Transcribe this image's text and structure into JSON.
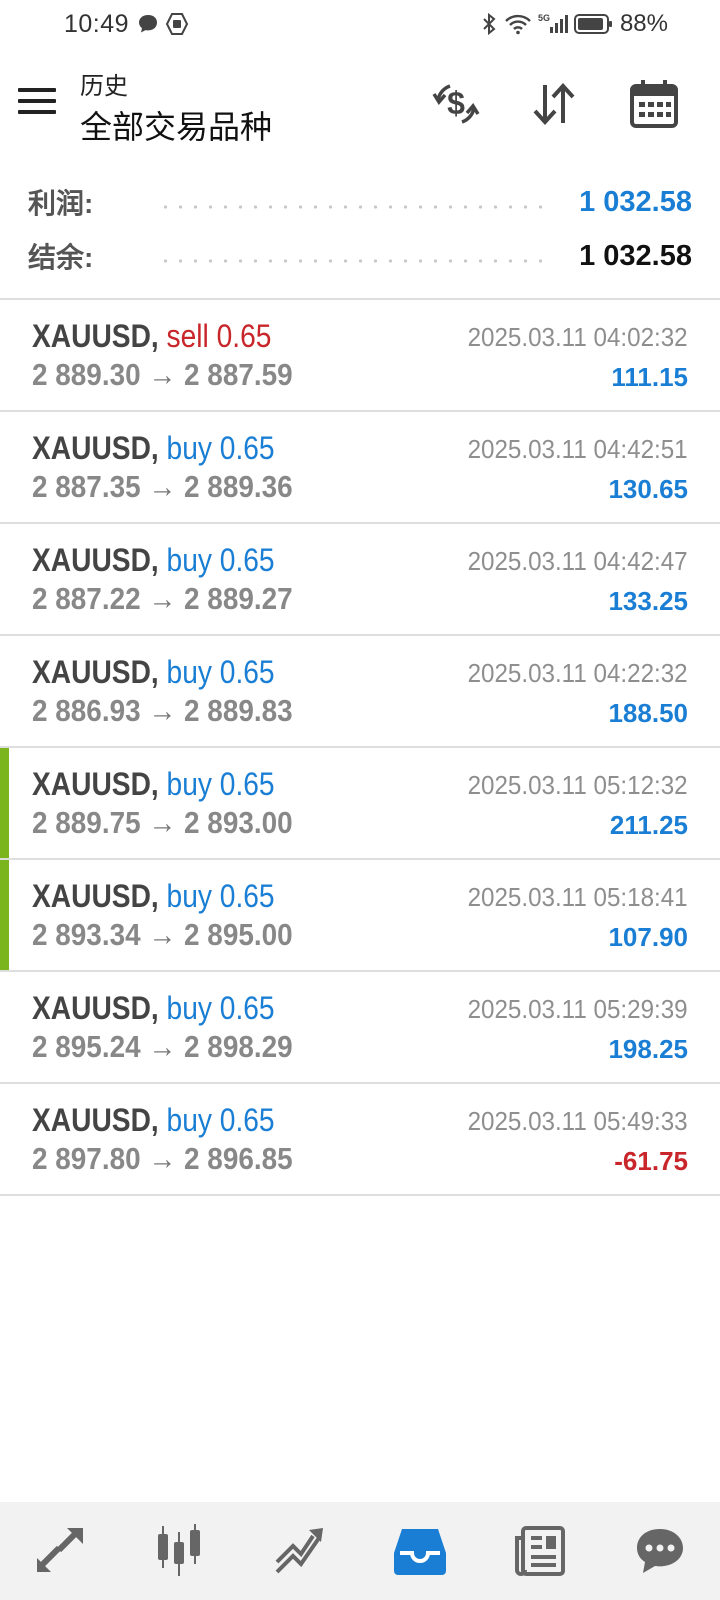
{
  "status_bar": {
    "time": "10:49",
    "battery": "88%",
    "icons": [
      "message-icon",
      "shield-icon",
      "bluetooth-icon",
      "wifi-icon",
      "5g-signal-icon",
      "battery-icon"
    ]
  },
  "header": {
    "subtitle": "历史",
    "title": "全部交易品种",
    "actions": [
      "currency-exchange-icon",
      "sort-icon",
      "calendar-icon"
    ]
  },
  "summary": {
    "profit_label": "利润:",
    "profit_value": "1 032.58",
    "balance_label": "结余:",
    "balance_value": "1 032.58"
  },
  "trades": [
    {
      "symbol": "XAUUSD",
      "sep": ",",
      "direction": "sell 0.65",
      "type": "sell",
      "open": "2 889.30",
      "arrow": "→",
      "close": "2 887.59",
      "datetime": "2025.03.11 04:02:32",
      "profit": "111.15",
      "profit_sign": "pos",
      "highlight": false
    },
    {
      "symbol": "XAUUSD",
      "sep": ",",
      "direction": "buy 0.65",
      "type": "buy",
      "open": "2 887.35",
      "arrow": "→",
      "close": "2 889.36",
      "datetime": "2025.03.11 04:42:51",
      "profit": "130.65",
      "profit_sign": "pos",
      "highlight": false
    },
    {
      "symbol": "XAUUSD",
      "sep": ",",
      "direction": "buy 0.65",
      "type": "buy",
      "open": "2 887.22",
      "arrow": "→",
      "close": "2 889.27",
      "datetime": "2025.03.11 04:42:47",
      "profit": "133.25",
      "profit_sign": "pos",
      "highlight": false
    },
    {
      "symbol": "XAUUSD",
      "sep": ",",
      "direction": "buy 0.65",
      "type": "buy",
      "open": "2 886.93",
      "arrow": "→",
      "close": "2 889.83",
      "datetime": "2025.03.11 04:22:32",
      "profit": "188.50",
      "profit_sign": "pos",
      "highlight": false
    },
    {
      "symbol": "XAUUSD",
      "sep": ",",
      "direction": "buy 0.65",
      "type": "buy",
      "open": "2 889.75",
      "arrow": "→",
      "close": "2 893.00",
      "datetime": "2025.03.11 05:12:32",
      "profit": "211.25",
      "profit_sign": "pos",
      "highlight": true
    },
    {
      "symbol": "XAUUSD",
      "sep": ",",
      "direction": "buy 0.65",
      "type": "buy",
      "open": "2 893.34",
      "arrow": "→",
      "close": "2 895.00",
      "datetime": "2025.03.11 05:18:41",
      "profit": "107.90",
      "profit_sign": "pos",
      "highlight": true
    },
    {
      "symbol": "XAUUSD",
      "sep": ",",
      "direction": "buy 0.65",
      "type": "buy",
      "open": "2 895.24",
      "arrow": "→",
      "close": "2 898.29",
      "datetime": "2025.03.11 05:29:39",
      "profit": "198.25",
      "profit_sign": "pos",
      "highlight": false
    },
    {
      "symbol": "XAUUSD",
      "sep": ",",
      "direction": "buy 0.65",
      "type": "buy",
      "open": "2 897.80",
      "arrow": "→",
      "close": "2 896.85",
      "datetime": "2025.03.11 05:49:33",
      "profit": "-61.75",
      "profit_sign": "neg",
      "highlight": false
    }
  ],
  "bottom_nav": [
    {
      "icon": "quotes-icon",
      "active": false
    },
    {
      "icon": "chart-icon",
      "active": false
    },
    {
      "icon": "trade-icon",
      "active": false
    },
    {
      "icon": "history-icon",
      "active": true
    },
    {
      "icon": "news-icon",
      "active": false
    },
    {
      "icon": "chat-icon",
      "active": false
    }
  ],
  "colors": {
    "accent_blue": "#1a7fd4",
    "sell_red": "#c8262a",
    "highlight_green": "#7ab51d",
    "active_tab_blue": "#1a7fd4",
    "icon_gray": "#666666"
  }
}
